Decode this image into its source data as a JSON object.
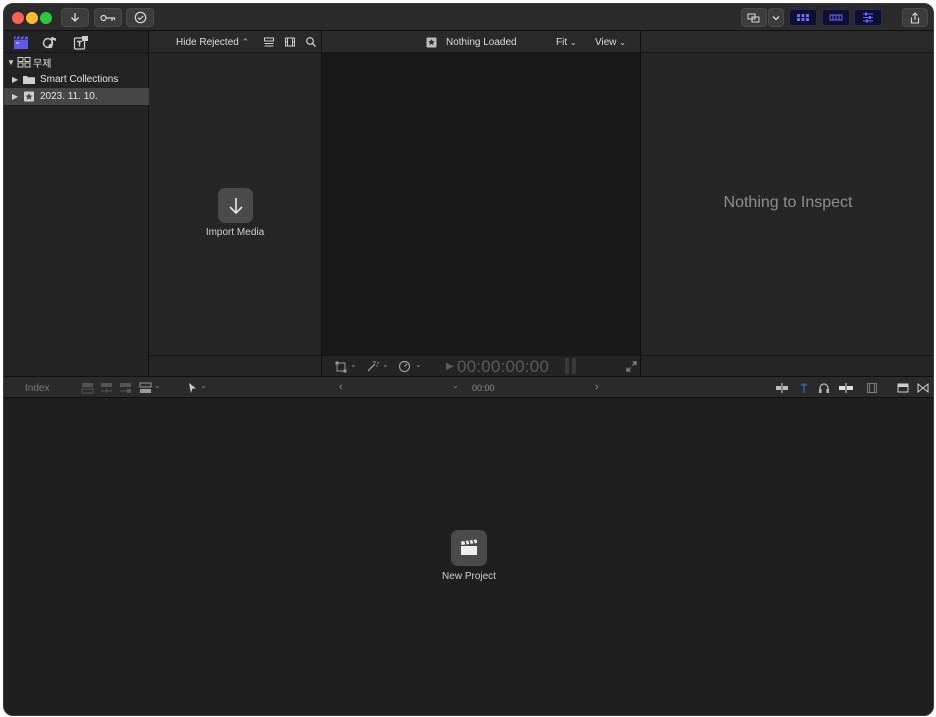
{
  "library": {
    "items": [
      {
        "label": "무제",
        "expanded": true,
        "icon": "library-icon"
      },
      {
        "label": "Smart Collections",
        "expanded": false,
        "icon": "folder-icon"
      },
      {
        "label": "2023. 11. 10.",
        "expanded": false,
        "icon": "event-icon",
        "selected": true
      }
    ]
  },
  "browser": {
    "filter_label": "Hide Rejected",
    "import_label": "Import Media"
  },
  "viewer": {
    "title": "Nothing Loaded",
    "fit_label": "Fit",
    "view_label": "View",
    "timecode": "00:00:00:00"
  },
  "inspector": {
    "empty_text": "Nothing to Inspect"
  },
  "timeline": {
    "index_label": "Index",
    "timecode": "00:00",
    "new_project_label": "New Project"
  },
  "colors": {
    "accent": "#5e5ce6",
    "window_bg": "#1e1e1e"
  }
}
